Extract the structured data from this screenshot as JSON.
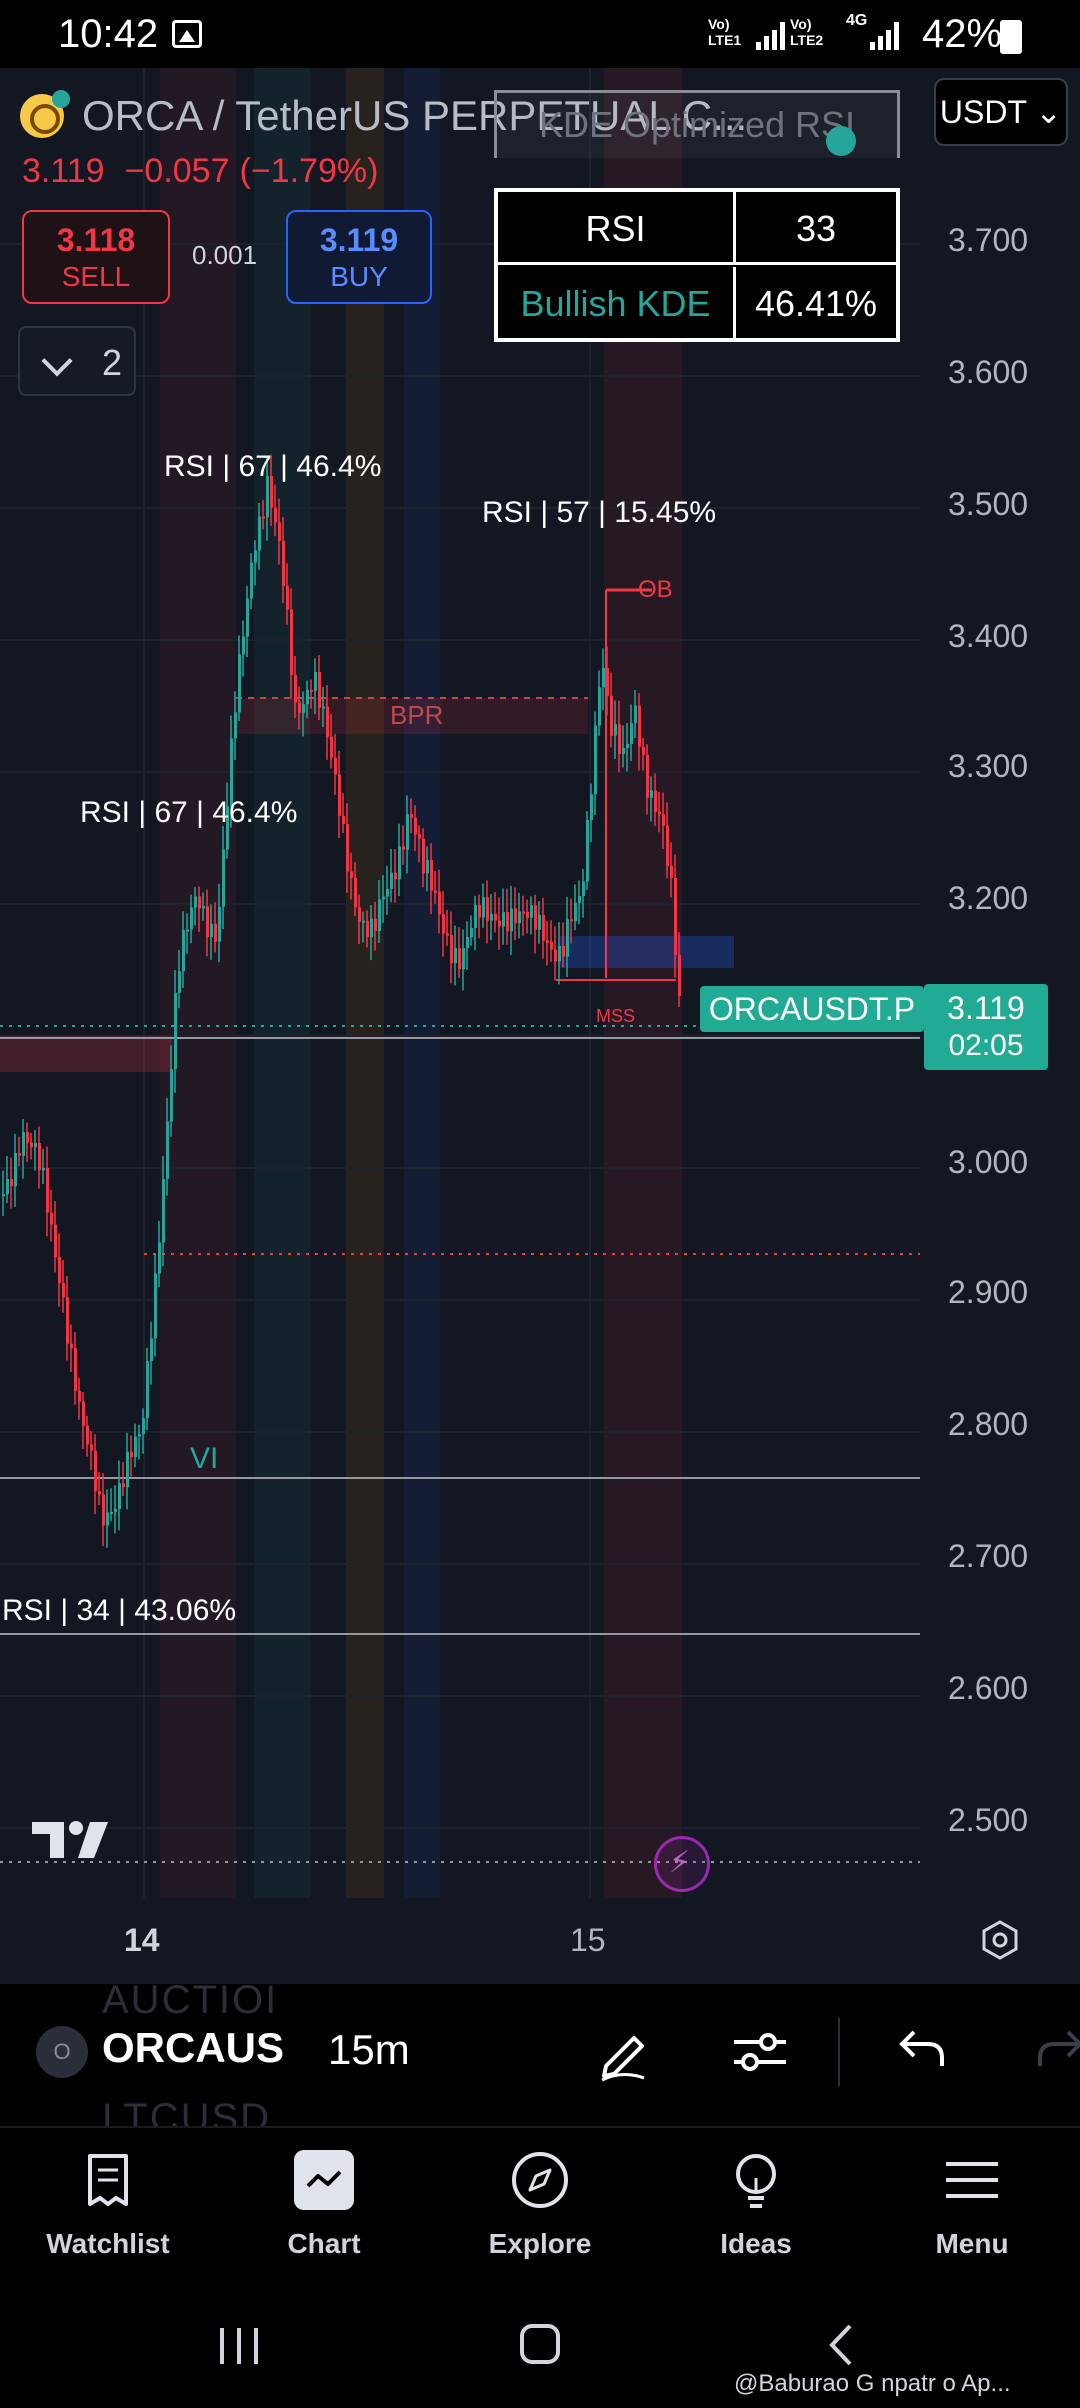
{
  "status_bar": {
    "time": "10:42",
    "sim1_label": "Vo) LTE1",
    "sim2_label": "Vo) LTE2",
    "sim2_network": "4G",
    "battery": "42%"
  },
  "header": {
    "symbol_title": "ORCA / TetherUS PERPETUAL C...",
    "last_price": "3.119",
    "change": "−0.057",
    "change_pct": "(−1.79%)",
    "sell_price": "3.118",
    "sell_label": "SELL",
    "spread": "0.001",
    "buy_price": "3.119",
    "buy_label": "BUY",
    "indicator_count": "2",
    "currency": "USDT ⌄"
  },
  "kde_table": {
    "title": "KDE Optimized RSI",
    "rows": [
      {
        "label": "RSI",
        "value": "33"
      },
      {
        "label": "Bullish KDE",
        "value": "46.41%"
      }
    ]
  },
  "chart": {
    "symbol_tag": "ORCAUSDT.P",
    "current_price": "3.119",
    "countdown": "02:05",
    "y_ticks": [
      "3.700",
      "3.600",
      "3.500",
      "3.400",
      "3.300",
      "3.200",
      "3.000",
      "2.900",
      "2.800",
      "2.700",
      "2.600",
      "2.500"
    ],
    "x_ticks": [
      "14",
      "15"
    ],
    "annotations": {
      "rsi_a": "RSI | 67 | 46.4%",
      "rsi_b": "RSI | 57 | 15.45%",
      "rsi_c": "RSI | 67 | 46.4%",
      "rsi_d": "RSI | 34 | 43.06%",
      "vi": "VI",
      "bpr": "BPR",
      "ob": "-OB",
      "mss": "MSS"
    },
    "colors": {
      "up": "#26a69a",
      "down": "#f23645",
      "background": "#131722",
      "accent": "#22ab94"
    }
  },
  "toolbar": {
    "avatar": "O",
    "symbol": "ORCAUS",
    "interval": "15m",
    "ghost_top": "AUCTIOI",
    "ghost_bottom": "LTCUSD"
  },
  "bottom_nav": {
    "items": [
      {
        "label": "Watchlist",
        "icon": "watchlist-icon"
      },
      {
        "label": "Chart",
        "icon": "chart-icon"
      },
      {
        "label": "Explore",
        "icon": "compass-icon"
      },
      {
        "label": "Ideas",
        "icon": "lightbulb-icon"
      },
      {
        "label": "Menu",
        "icon": "menu-icon"
      }
    ]
  },
  "watermark": "@Baburao G npatr o Ap..."
}
